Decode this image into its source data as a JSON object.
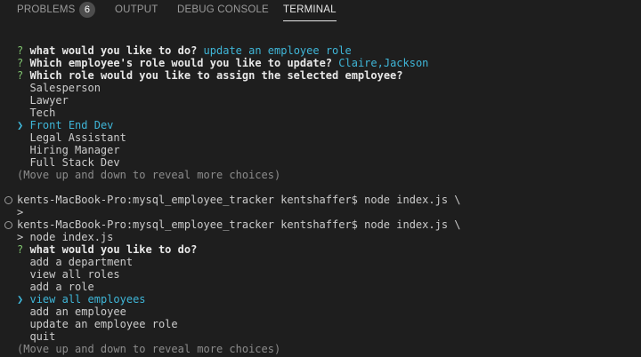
{
  "tabs": {
    "problems": "PROBLEMS",
    "problems_count": "6",
    "output": "OUTPUT",
    "debug": "DEBUG CONSOLE",
    "terminal": "TERMINAL"
  },
  "terminal": {
    "block1": {
      "q1_label": "what would you like to do?",
      "q1_answer": "update an employee role",
      "q2_label": "Which employee's role would you like to update?",
      "q2_answer": "Claire,Jackson",
      "q3_label": "Which role would you like to assign the selected employee?",
      "options": [
        "Salesperson",
        "Lawyer",
        "Tech",
        "Front End Dev",
        "Legal Assistant",
        "Hiring Manager",
        "Full Stack Dev"
      ],
      "selected": "Front End Dev",
      "hint": "(Move up and down to reveal more choices)"
    },
    "cmd1": "kents-MacBook-Pro:mysql_employee_tracker kentshaffer$ node index.js \\",
    "cont1": ">",
    "cmd2": "kents-MacBook-Pro:mysql_employee_tracker kentshaffer$ node index.js \\",
    "cont2": "> node index.js",
    "block2": {
      "q1_label": "what would you like to do?",
      "options": [
        "add a department",
        "view all roles",
        "add a role",
        "view all employees",
        "add an employee",
        "update an employee role",
        "quit"
      ],
      "selected": "view all employees",
      "hint": "(Move up and down to reveal more choices)"
    },
    "prompt_mark": "?",
    "pointer": "❯",
    "colors": {
      "background": "#1e1e1e",
      "question_mark": "#7fc36e",
      "answer": "#3fb6d8",
      "hint": "#8c8c8c"
    }
  }
}
